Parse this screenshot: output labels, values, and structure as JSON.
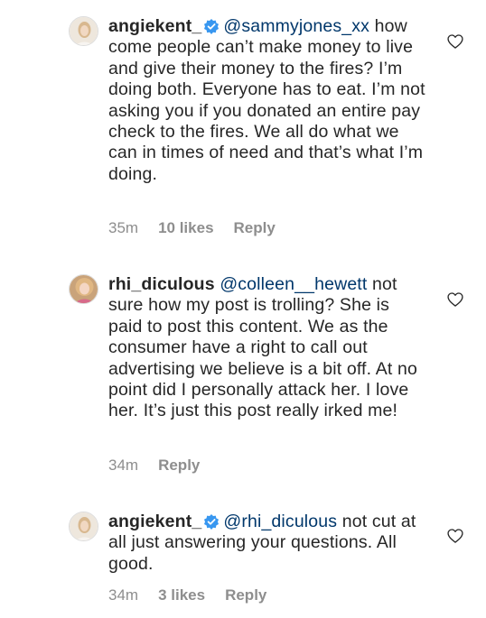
{
  "comments": [
    {
      "username": "angiekent_",
      "verified": true,
      "mention": "@sammyjones_xx",
      "text": "how come people can’t make money to live and give their money to the fires? I’m doing both. Everyone has to eat. I’m not asking you if you donated an entire pay check to the fires. We all do what we can in times of need and that’s what I’m doing.",
      "time": "35m",
      "likes": "10 likes",
      "reply": "Reply"
    },
    {
      "username": "rhi_diculous",
      "verified": false,
      "mention": "@colleen__hewett",
      "text": "not sure how my post is trolling? She is paid to post this content. We as the consumer have a right to call out advertising we believe is a bit off. At no point did I personally attack her. I love her. It’s just this post really irked me!",
      "time": "34m",
      "likes": "",
      "reply": "Reply"
    },
    {
      "username": "angiekent_",
      "verified": true,
      "mention": "@rhi_diculous",
      "text": "not cut at all just answering your questions. All good.",
      "time": "34m",
      "likes": "3 likes",
      "reply": "Reply"
    }
  ],
  "colors": {
    "verified": "#3897f0",
    "mention": "#00376b",
    "meta": "#8e8e8e"
  }
}
